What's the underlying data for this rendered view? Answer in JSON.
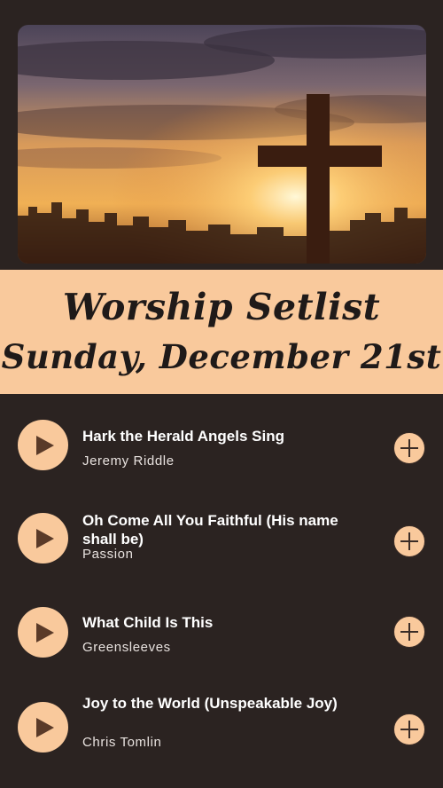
{
  "banner": {
    "title": "Worship Setlist",
    "date": "Sunday, December 21st"
  },
  "songs": [
    {
      "title": "Hark the Herald Angels Sing",
      "artist": "Jeremy Riddle"
    },
    {
      "title": "Oh Come All You Faithful (His name shall be)",
      "artist": "Passion"
    },
    {
      "title": "What Child Is This",
      "artist": "Greensleeves"
    },
    {
      "title": "Joy to the World (Unspeakable Joy)",
      "artist": "Chris Tomlin"
    }
  ],
  "icons": {
    "play": "play-icon",
    "add": "plus-icon"
  },
  "colors": {
    "background": "#2b2321",
    "accent": "#f9c99c",
    "text": "#ffffff"
  }
}
